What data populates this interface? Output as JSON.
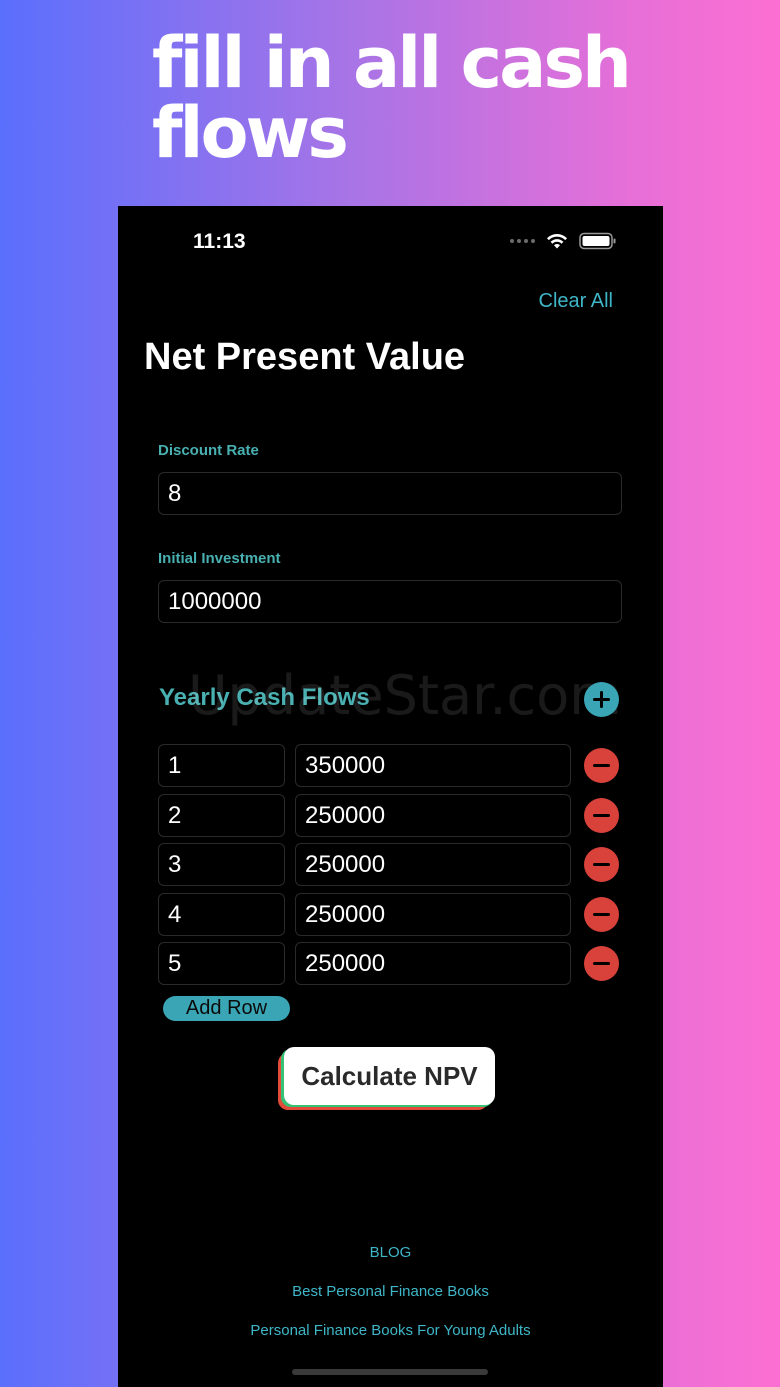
{
  "headline": "fill in all cash flows",
  "status": {
    "time": "11:13"
  },
  "header": {
    "clear_all": "Clear All",
    "title": "Net Present Value"
  },
  "form": {
    "discount_rate_label": "Discount Rate",
    "discount_rate_value": "8",
    "initial_investment_label": "Initial Investment",
    "initial_investment_value": "1000000"
  },
  "cash_flows": {
    "title": "Yearly Cash Flows",
    "rows": [
      {
        "year": "1",
        "amount": "350000"
      },
      {
        "year": "2",
        "amount": "250000"
      },
      {
        "year": "3",
        "amount": "250000"
      },
      {
        "year": "4",
        "amount": "250000"
      },
      {
        "year": "5",
        "amount": "250000"
      }
    ],
    "add_row": "Add Row"
  },
  "calculate": "Calculate NPV",
  "watermark": "UpdateStar.com",
  "footer": {
    "links": [
      "BLOG",
      "Best Personal Finance Books",
      "Personal Finance Books For Young Adults"
    ]
  },
  "colors": {
    "accent": "#3fb6c8",
    "label": "#49b0b2",
    "remove": "#d9423a",
    "background": "#000000"
  }
}
